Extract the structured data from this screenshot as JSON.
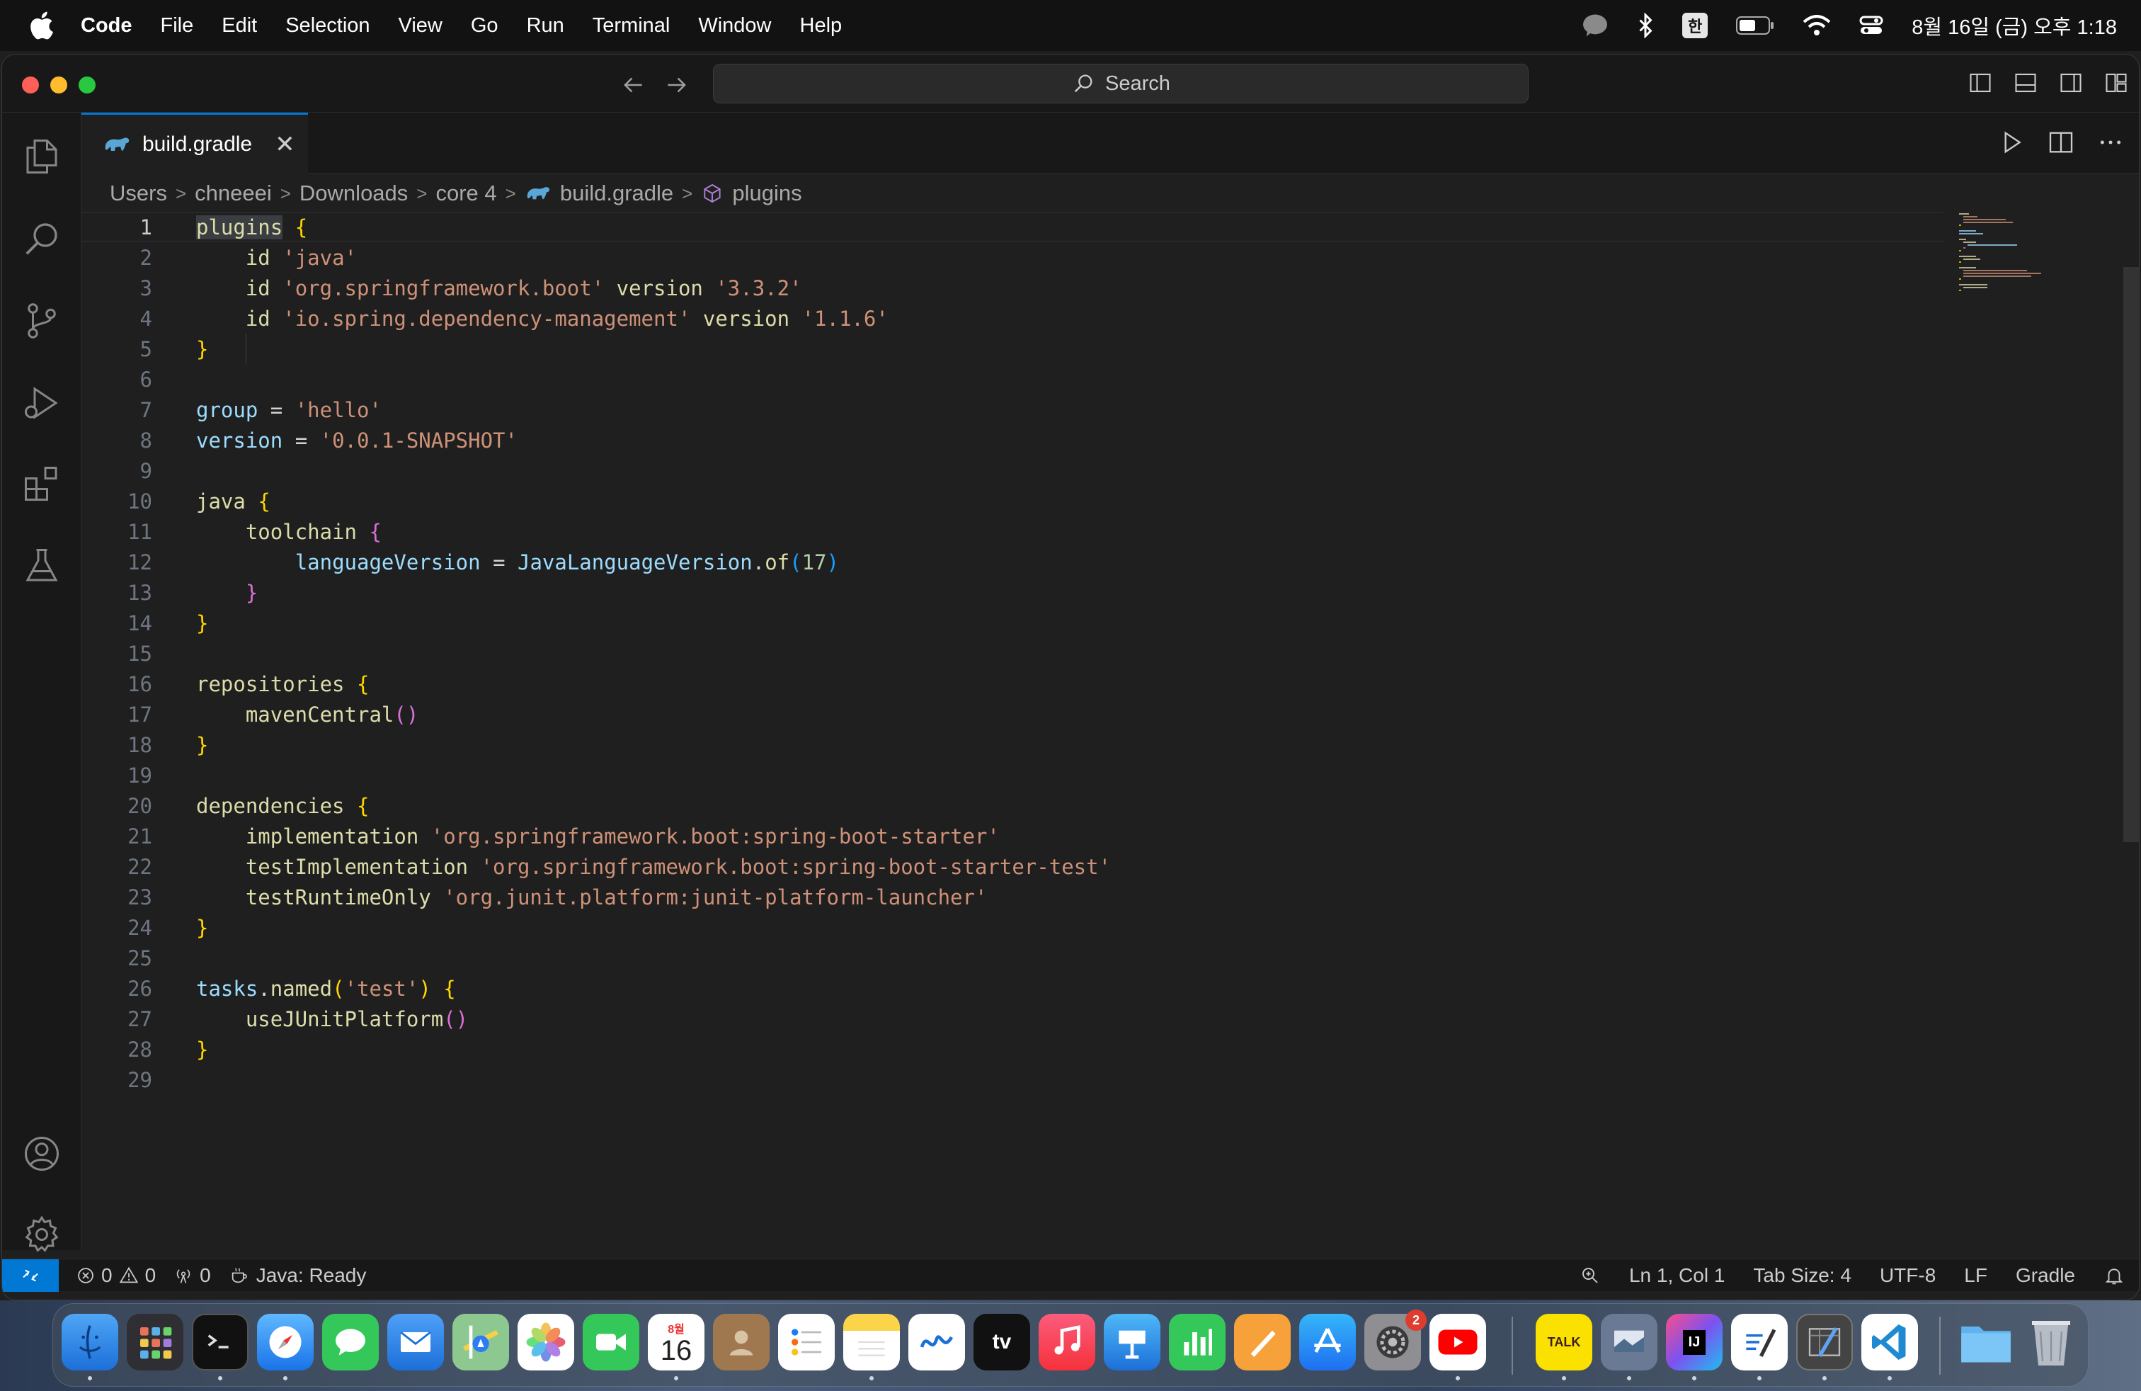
{
  "menubar": {
    "app_name": "Code",
    "items": [
      "File",
      "Edit",
      "Selection",
      "View",
      "Go",
      "Run",
      "Terminal",
      "Window",
      "Help"
    ],
    "ime": "한",
    "clock": "8월 16일 (금) 오후 1:18"
  },
  "titlebar": {
    "search_label": "Search"
  },
  "tab": {
    "label": "build.gradle",
    "close": "✕"
  },
  "breadcrumb": {
    "items": [
      "Users",
      "chneeei",
      "Downloads",
      "core 4",
      "build.gradle",
      "plugins"
    ]
  },
  "editor": {
    "line_numbers": [
      "1",
      "2",
      "3",
      "4",
      "5",
      "6",
      "7",
      "8",
      "9",
      "10",
      "11",
      "12",
      "13",
      "14",
      "15",
      "16",
      "17",
      "18",
      "19",
      "20",
      "21",
      "22",
      "23",
      "24",
      "25",
      "26",
      "27",
      "28",
      "29"
    ],
    "lines": [
      "plugins {",
      "    id 'java'",
      "    id 'org.springframework.boot' version '3.3.2'",
      "    id 'io.spring.dependency-management' version '1.1.6'",
      "}",
      "",
      "group = 'hello'",
      "version = '0.0.1-SNAPSHOT'",
      "",
      "java {",
      "    toolchain {",
      "        languageVersion = JavaLanguageVersion.of(17)",
      "    }",
      "}",
      "",
      "repositories {",
      "    mavenCentral()",
      "}",
      "",
      "dependencies {",
      "    implementation 'org.springframework.boot:spring-boot-starter'",
      "    testImplementation 'org.springframework.boot:spring-boot-starter-test'",
      "    testRuntimeOnly 'org.junit.platform:junit-platform-launcher'",
      "}",
      "",
      "tasks.named('test') {",
      "    useJUnitPlatform()",
      "}",
      ""
    ]
  },
  "statusbar": {
    "errors": "0",
    "warnings": "0",
    "ports": "0",
    "java_status": "Java: Ready",
    "position": "Ln 1, Col 1",
    "tab_size": "Tab Size: 4",
    "encoding": "UTF-8",
    "eol": "LF",
    "language": "Gradle"
  },
  "dock": {
    "calendar_month": "8월",
    "calendar_day": "16",
    "settings_badge": "2",
    "appletv_label": "tv",
    "kakao_label": "TALK",
    "intellij_label": "IJ"
  },
  "colors": {
    "accent": "#0078d4",
    "editor_bg": "#1f1f1f",
    "sidebar_bg": "#181818"
  }
}
